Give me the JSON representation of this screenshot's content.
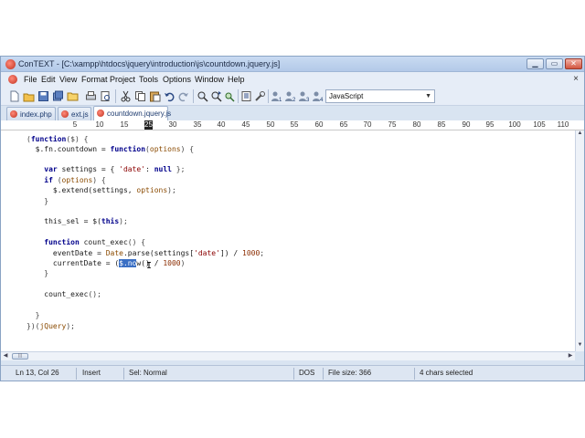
{
  "window": {
    "title": "ConTEXT - [C:\\xampp\\htdocs\\jquery\\introduction\\js\\countdown.jquery.js]",
    "buttons": {
      "minimize": "▁",
      "maximize": "▭",
      "close": "✕"
    }
  },
  "menu": {
    "items": [
      "File",
      "Edit",
      "View",
      "Format",
      "Project",
      "Tools",
      "Options",
      "Window",
      "Help"
    ],
    "close": "×"
  },
  "toolbar": {
    "language": "JavaScript",
    "icons": [
      "new-file-icon",
      "open-file-icon",
      "save-icon",
      "save-all-icon",
      "folder-icon",
      "print-icon",
      "print-preview-icon",
      "cut-icon",
      "copy-icon",
      "paste-icon",
      "undo-icon",
      "redo-icon",
      "find-icon",
      "find-next-icon",
      "replace-icon",
      "indent-icon",
      "tools-icon",
      "user-command-1-icon",
      "user-command-2-icon",
      "user-command-3-icon",
      "user-command-4-icon"
    ]
  },
  "tabs": [
    {
      "label": "index.php",
      "active": false
    },
    {
      "label": "ext.js",
      "active": false
    },
    {
      "label": "countdown.jquery.js",
      "active": true
    }
  ],
  "ruler": {
    "numbers": [
      "5",
      "10",
      "15",
      "20",
      "25",
      "30",
      "35",
      "40",
      "45",
      "50",
      "55",
      "60",
      "65",
      "70",
      "75",
      "80",
      "85",
      "90",
      "95",
      "100",
      "105",
      "110"
    ],
    "caret_marker": "25"
  },
  "code": {
    "lines": [
      "(function($) {",
      "  $.fn.countdown = function(options) {",
      "",
      "    var settings = { 'date': null };",
      "    if (options) {",
      "      $.extend(settings, options);",
      "    }",
      "",
      "    this_sel = $(this);",
      "",
      "    function count_exec() {",
      "      eventDate = Date.parse(settings['date']) / 1000;",
      "      currentDate = ($.now() / 1000)",
      "    }",
      "",
      "    count_exec();",
      "",
      "  }",
      "})(jQuery);"
    ],
    "selected_text": "$.no"
  },
  "status": {
    "position": "Ln 13, Col 26",
    "insert_mode": "Insert",
    "selection_mode": "Sel: Normal",
    "line_endings": "DOS",
    "file_size": "File size: 366",
    "selection_info": "4 chars selected"
  },
  "colors": {
    "keyword": "#00008b",
    "string": "#8b0000",
    "selection": "#3a6fc4",
    "chrome": "#d9e4f1"
  }
}
